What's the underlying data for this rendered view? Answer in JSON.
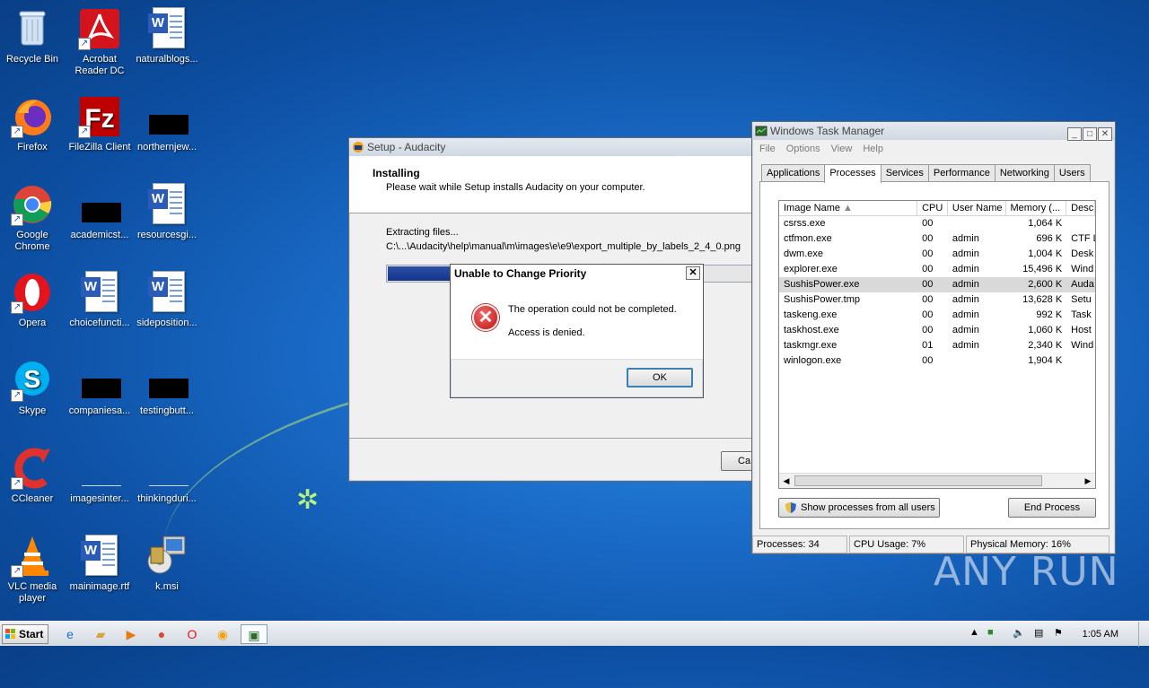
{
  "desktop": {
    "icons": [
      {
        "label": "Recycle Bin",
        "icon": "recycle-bin-icon"
      },
      {
        "label": "Acrobat Reader DC",
        "icon": "acrobat-icon"
      },
      {
        "label": "naturalblogs...",
        "icon": "word-doc-icon"
      },
      {
        "label": "Firefox",
        "icon": "firefox-icon"
      },
      {
        "label": "FileZilla Client",
        "icon": "filezilla-icon"
      },
      {
        "label": "northernjew...",
        "icon": "redacted-icon"
      },
      {
        "label": "Google Chrome",
        "icon": "chrome-icon"
      },
      {
        "label": "academicst...",
        "icon": "redacted-icon"
      },
      {
        "label": "resourcesgi...",
        "icon": "word-doc-icon"
      },
      {
        "label": "Opera",
        "icon": "opera-icon"
      },
      {
        "label": "choicefuncti...",
        "icon": "word-doc-icon"
      },
      {
        "label": "sideposition...",
        "icon": "word-doc-icon"
      },
      {
        "label": "Skype",
        "icon": "skype-icon"
      },
      {
        "label": "companiesa...",
        "icon": "redacted-icon"
      },
      {
        "label": "testingbutt...",
        "icon": "redacted-icon"
      },
      {
        "label": "CCleaner",
        "icon": "ccleaner-icon"
      },
      {
        "label": "imagesinter...",
        "icon": "blank-doc-icon"
      },
      {
        "label": "thinkingduri...",
        "icon": "blank-doc-icon"
      },
      {
        "label": "VLC media player",
        "icon": "vlc-icon"
      },
      {
        "label": "mainimage.rtf",
        "icon": "word-doc-icon"
      },
      {
        "label": "k.msi",
        "icon": "msi-installer-icon"
      }
    ]
  },
  "setup": {
    "title": "Setup - Audacity",
    "heading": "Installing",
    "subheading": "Please wait while Setup installs Audacity on your computer.",
    "status": "Extracting files...",
    "path": "C:\\...\\Audacity\\help\\manual\\m\\images\\e\\e9\\export_multiple_by_labels_2_4_0.png",
    "progress_pct": 50,
    "cancel_label": "Ca"
  },
  "error_dialog": {
    "title": "Unable to Change Priority",
    "line1": "The operation could not be completed.",
    "line2": "Access is denied.",
    "ok_label": "OK",
    "close_label": "✕"
  },
  "taskmgr": {
    "title": "Windows Task Manager",
    "menu": [
      "File",
      "Options",
      "View",
      "Help"
    ],
    "tabs": [
      "Applications",
      "Processes",
      "Services",
      "Performance",
      "Networking",
      "Users"
    ],
    "active_tab": "Processes",
    "columns": [
      "Image Name",
      "CPU",
      "User Name",
      "Memory (...",
      "Desc"
    ],
    "rows": [
      {
        "name": "csrss.exe",
        "cpu": "00",
        "user": "",
        "mem": "1,064 K",
        "desc": ""
      },
      {
        "name": "ctfmon.exe",
        "cpu": "00",
        "user": "admin",
        "mem": "696 K",
        "desc": "CTF L"
      },
      {
        "name": "dwm.exe",
        "cpu": "00",
        "user": "admin",
        "mem": "1,004 K",
        "desc": "Desk"
      },
      {
        "name": "explorer.exe",
        "cpu": "00",
        "user": "admin",
        "mem": "15,496 K",
        "desc": "Wind"
      },
      {
        "name": "SushisPower.exe",
        "cpu": "00",
        "user": "admin",
        "mem": "2,600 K",
        "desc": "Auda"
      },
      {
        "name": "SushisPower.tmp",
        "cpu": "00",
        "user": "admin",
        "mem": "13,628 K",
        "desc": "Setu"
      },
      {
        "name": "taskeng.exe",
        "cpu": "00",
        "user": "admin",
        "mem": "992 K",
        "desc": "Task"
      },
      {
        "name": "taskhost.exe",
        "cpu": "00",
        "user": "admin",
        "mem": "1,060 K",
        "desc": "Host"
      },
      {
        "name": "taskmgr.exe",
        "cpu": "01",
        "user": "admin",
        "mem": "2,340 K",
        "desc": "Wind"
      },
      {
        "name": "winlogon.exe",
        "cpu": "00",
        "user": "",
        "mem": "1,904 K",
        "desc": ""
      }
    ],
    "selected_row": 4,
    "show_all_label": "Show processes from all users",
    "end_process_label": "End Process",
    "status": {
      "processes": "Processes: 34",
      "cpu": "CPU Usage: 7%",
      "memory": "Physical Memory: 16%"
    }
  },
  "taskbar": {
    "start_label": "Start",
    "apps": [
      "ie-icon",
      "explorer-folder-icon",
      "media-player-icon",
      "chrome-icon",
      "opera-icon",
      "audacity-setup-icon",
      "task-manager-icon"
    ],
    "clock": "1:05 AM"
  },
  "watermark": "ANY RUN"
}
